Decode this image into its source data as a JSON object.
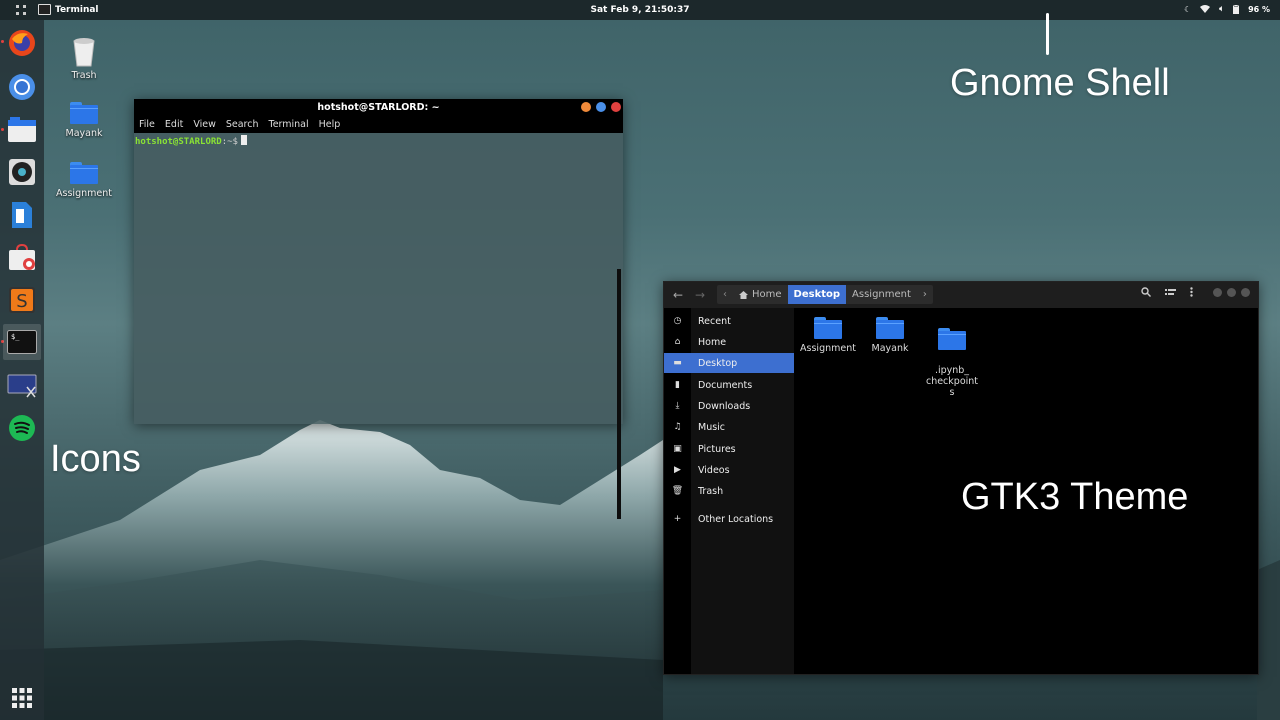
{
  "topbar": {
    "app_name": "Terminal",
    "clock": "Sat Feb  9, 21:50:37",
    "battery": "96 %"
  },
  "dock": {
    "items": [
      "firefox-icon",
      "chromium-icon",
      "files-icon",
      "music-player-icon",
      "libreoffice-writer-icon",
      "software-center-icon",
      "sublime-text-icon",
      "terminal-icon",
      "screenshot-tool-icon",
      "spotify-icon"
    ],
    "apps_grid": "show-applications-icon"
  },
  "desktop": {
    "icons": [
      {
        "label": "Trash"
      },
      {
        "label": "Mayank"
      },
      {
        "label": "Assignment"
      }
    ]
  },
  "annotations": {
    "gnome_shell": "Gnome Shell",
    "icons": "Icons",
    "gtk3_theme": "GTK3 Theme"
  },
  "terminal": {
    "title": "hotshot@STARLORD: ~",
    "menu": [
      "File",
      "Edit",
      "View",
      "Search",
      "Terminal",
      "Help"
    ],
    "prompt_user": "hotshot@STARLORD",
    "prompt_rest": ":~$"
  },
  "files": {
    "path": [
      "Home",
      "Desktop",
      "Assignment"
    ],
    "sidebar": [
      {
        "label": "Recent",
        "icon": "clock-icon"
      },
      {
        "label": "Home",
        "icon": "home-icon"
      },
      {
        "label": "Desktop",
        "icon": "desktop-icon"
      },
      {
        "label": "Documents",
        "icon": "document-icon"
      },
      {
        "label": "Downloads",
        "icon": "download-icon"
      },
      {
        "label": "Music",
        "icon": "music-icon"
      },
      {
        "label": "Pictures",
        "icon": "pictures-icon"
      },
      {
        "label": "Videos",
        "icon": "video-icon"
      },
      {
        "label": "Trash",
        "icon": "trash-icon"
      },
      {
        "label": "Other Locations",
        "icon": "plus-icon"
      }
    ],
    "items": [
      {
        "label": "Assignment"
      },
      {
        "label": "Mayank"
      },
      {
        "label": ".ipynb_\ncheckpoint\ns"
      }
    ]
  },
  "colors": {
    "accent": "#3d6fd0",
    "folder": "#2c76e8",
    "prompt": "#8ae234"
  }
}
